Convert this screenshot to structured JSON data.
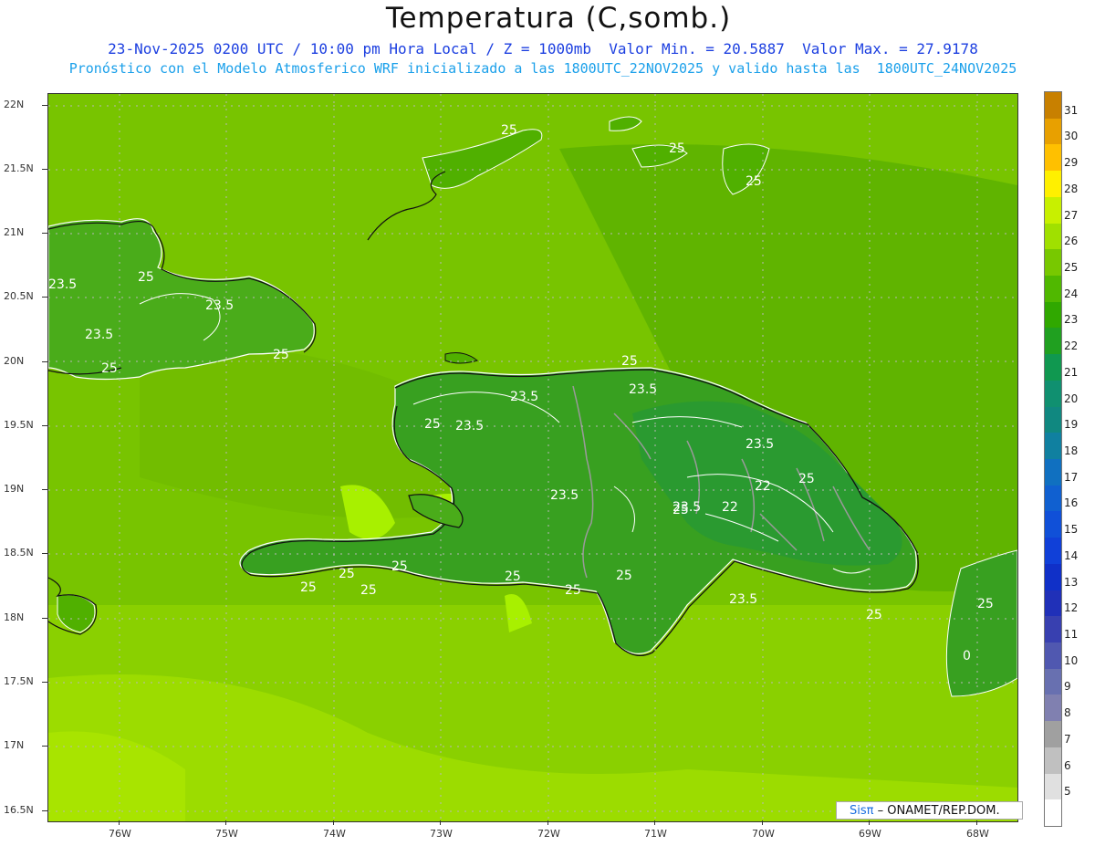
{
  "header": {
    "title": "Temperatura (C,somb.)",
    "line1": "23-Nov-2025 0200 UTC / 10:00 pm Hora Local / Z = 1000mb  Valor Min. = 20.5887  Valor Max. = 27.9178",
    "line2": "Pronóstico con el Modelo Atmosferico WRF inicializado a las 1800UTC_22NOV2025 y valido hasta las  1800UTC_24NOV2025"
  },
  "axes": {
    "lat_labels": [
      "22N",
      "21.5N",
      "21N",
      "20.5N",
      "20N",
      "19.5N",
      "19N",
      "18.5N",
      "18N",
      "17.5N",
      "17N",
      "16.5N"
    ],
    "lon_labels": [
      "76W",
      "75W",
      "74W",
      "73W",
      "72W",
      "71W",
      "70W",
      "69W",
      "68W"
    ]
  },
  "colorbar": {
    "labels": [
      "31",
      "30",
      "29",
      "28",
      "27",
      "26",
      "25",
      "24",
      "23",
      "22",
      "21",
      "20",
      "19",
      "18",
      "17",
      "16",
      "15",
      "14",
      "13",
      "12",
      "11",
      "10",
      "9",
      "8",
      "7",
      "6",
      "5"
    ],
    "colors": [
      "#c88000",
      "#e8a000",
      "#ffc000",
      "#fff000",
      "#c8f000",
      "#a0e000",
      "#78c800",
      "#50b800",
      "#30a800",
      "#20a020",
      "#109850",
      "#109070",
      "#108880",
      "#1080a0",
      "#1070c0",
      "#1060d0",
      "#1050d8",
      "#1040d8",
      "#1030c8",
      "#2030b8",
      "#3840b0",
      "#5058b0",
      "#6870b0",
      "#8080b0",
      "#a0a0a0",
      "#c0c0c0",
      "#e0e0e0",
      "#ffffff"
    ]
  },
  "map": {
    "contour_labels": [
      "25",
      "25",
      "25",
      "25",
      "25",
      "23.5",
      "25",
      "25",
      "23.5",
      "23.5",
      "25",
      "23.5",
      "25",
      "23.5",
      "23.5",
      "25",
      "23.5",
      "22",
      "22",
      "23.5",
      "23.5",
      "25",
      "25",
      "25",
      "25",
      "25",
      "25",
      "25",
      "23.5",
      "25",
      "25",
      "0"
    ]
  },
  "credit": {
    "sis": "Sisπ",
    "rest": "– ONAMET/REP.DOM."
  }
}
